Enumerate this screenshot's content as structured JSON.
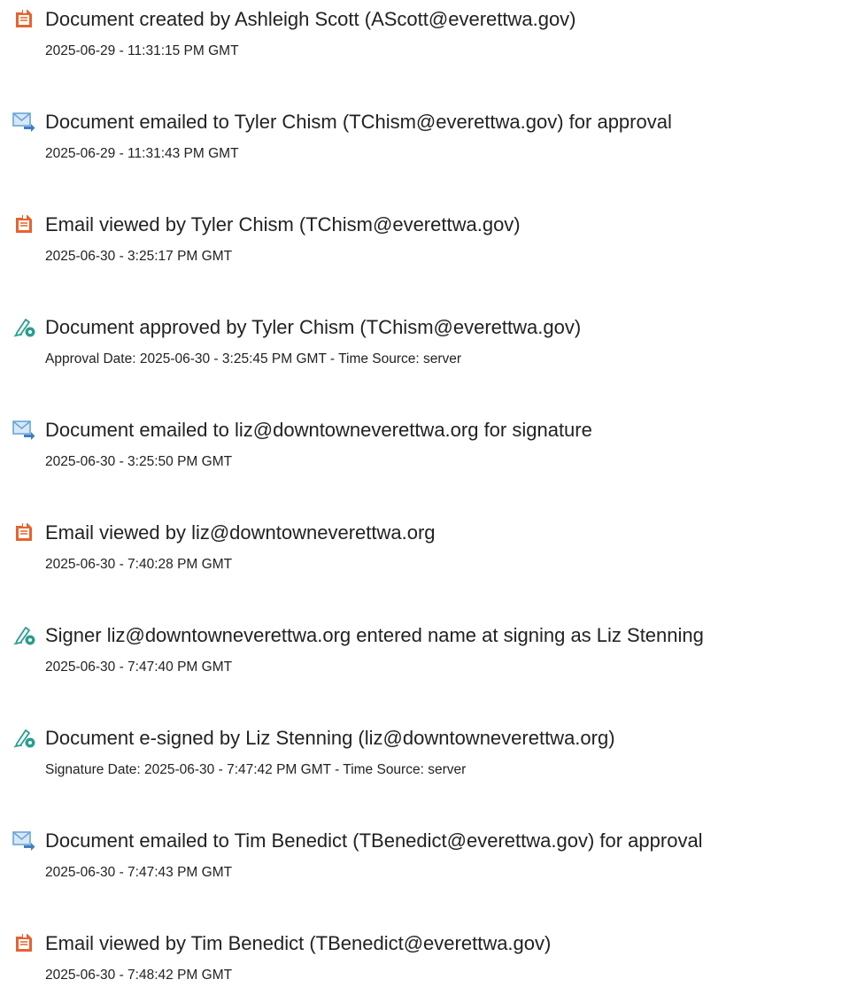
{
  "events": [
    {
      "icon": "document-orange-icon",
      "title": "Document created by Ashleigh Scott (AScott@everettwa.gov)",
      "subtitle": "2025-06-29 - 11:31:15 PM GMT"
    },
    {
      "icon": "email-send-icon",
      "title": "Document emailed to Tyler Chism (TChism@everettwa.gov) for approval",
      "subtitle": "2025-06-29 - 11:31:43 PM GMT"
    },
    {
      "icon": "document-orange-icon",
      "title": "Email viewed by Tyler Chism (TChism@everettwa.gov)",
      "subtitle": "2025-06-30 - 3:25:17 PM GMT"
    },
    {
      "icon": "pen-sign-icon",
      "title": "Document approved by Tyler Chism (TChism@everettwa.gov)",
      "subtitle": "Approval Date: 2025-06-30 - 3:25:45 PM GMT - Time Source: server"
    },
    {
      "icon": "email-send-icon",
      "title": "Document emailed to liz@downtowneverettwa.org for signature",
      "subtitle": "2025-06-30 - 3:25:50 PM GMT"
    },
    {
      "icon": "document-orange-icon",
      "title": "Email viewed by liz@downtowneverettwa.org",
      "subtitle": "2025-06-30 - 7:40:28 PM GMT"
    },
    {
      "icon": "pen-sign-icon",
      "title": "Signer liz@downtowneverettwa.org entered name at signing as Liz Stenning",
      "subtitle": "2025-06-30 - 7:47:40 PM GMT"
    },
    {
      "icon": "pen-sign-icon",
      "title": "Document e-signed by Liz Stenning (liz@downtowneverettwa.org)",
      "subtitle": "Signature Date: 2025-06-30 - 7:47:42 PM GMT - Time Source: server"
    },
    {
      "icon": "email-send-icon",
      "title": "Document emailed to Tim Benedict (TBenedict@everettwa.gov) for approval",
      "subtitle": "2025-06-30 - 7:47:43 PM GMT"
    },
    {
      "icon": "document-orange-icon",
      "title": "Email viewed by Tim Benedict (TBenedict@everettwa.gov)",
      "subtitle": "2025-06-30 - 7:48:42 PM GMT"
    }
  ],
  "colors": {
    "document_icon": "#e8622c",
    "email_icon": "#6aa5d8",
    "email_arrow": "#3d7fc4",
    "pen_icon": "#2a9d8f",
    "text": "#222222"
  }
}
